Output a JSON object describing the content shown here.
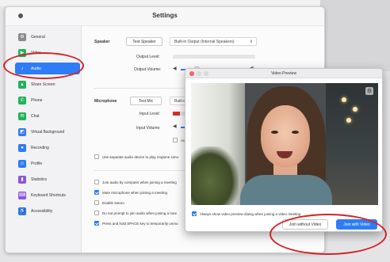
{
  "colors": {
    "accent": "#2e7cf6",
    "annotation": "#d42424",
    "level": "#d62f2f"
  },
  "settings": {
    "title": "Settings",
    "sidebar": [
      {
        "label": "General",
        "icon": "gear-icon",
        "glyph": "⚙",
        "color": "#8a8a8a"
      },
      {
        "label": "Video",
        "icon": "video-camera-icon",
        "glyph": "▶",
        "color": "#1fb25a"
      },
      {
        "label": "Audio",
        "icon": "headphones-icon",
        "glyph": "♪",
        "color": "#2e7cf6",
        "active": true
      },
      {
        "label": "Share Screen",
        "icon": "share-screen-icon",
        "glyph": "▲",
        "color": "#1fb25a"
      },
      {
        "label": "Phone",
        "icon": "phone-icon",
        "glyph": "✆",
        "color": "#1fb25a"
      },
      {
        "label": "Chat",
        "icon": "chat-icon",
        "glyph": "✉",
        "color": "#1fb25a"
      },
      {
        "label": "Virtual Background",
        "icon": "virtual-background-icon",
        "glyph": "◩",
        "color": "#2e7cf6"
      },
      {
        "label": "Recording",
        "icon": "recording-icon",
        "glyph": "●",
        "color": "#2e7cf6"
      },
      {
        "label": "Profile",
        "icon": "profile-icon",
        "glyph": "☺",
        "color": "#2e7cf6"
      },
      {
        "label": "Statistics",
        "icon": "statistics-icon",
        "glyph": "▮",
        "color": "#8b55e0"
      },
      {
        "label": "Keyboard Shortcuts",
        "icon": "keyboard-icon",
        "glyph": "⌨",
        "color": "#8b55e0"
      },
      {
        "label": "Accessibility",
        "icon": "accessibility-icon",
        "glyph": "♿",
        "color": "#2e7cf6"
      }
    ],
    "speaker": {
      "label": "Speaker",
      "test_button": "Test Speaker",
      "device": "Built-in Output (Internal Speakers)",
      "output_level_label": "Output Level:",
      "output_volume_label": "Output Volume:",
      "volume": 0.25
    },
    "microphone": {
      "label": "Microphone",
      "test_button": "Test Mic",
      "device": "Built-in Microphone",
      "input_level_label": "Input Level:",
      "input_volume_label": "Input Volume:",
      "input_level": 0.4,
      "auto_adjust_label": "Autom"
    },
    "ringtone_label": "Use separate audio device to play ringtone simu",
    "options": [
      {
        "label": "Join audio by computer when joining a meeting",
        "checked": false
      },
      {
        "label": "Mute microphone when joining a meeting",
        "checked": true
      },
      {
        "label": "Enable stereo",
        "checked": false
      },
      {
        "label": "Do not prompt to join audio when joining a mee",
        "checked": false
      },
      {
        "label": "Press and hold SPACE key to temporarily unmu",
        "checked": true
      }
    ]
  },
  "preview": {
    "title": "Video Preview",
    "always_show_label": "Always show video preview dialog when joining a video meeting",
    "always_show_checked": true,
    "join_without_video": "Join without Video",
    "join_with_video": "Join with Video"
  }
}
